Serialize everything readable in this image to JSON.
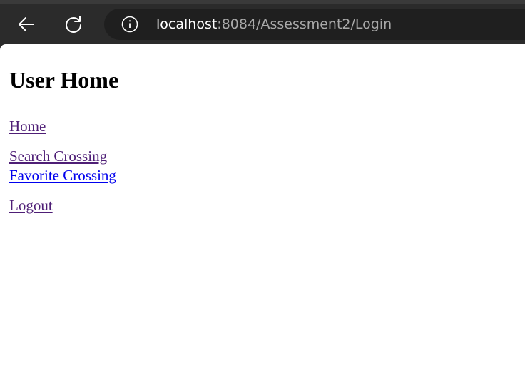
{
  "browser": {
    "url_host": "localhost",
    "url_path": ":8084/Assessment2/Login",
    "icons": {
      "back": "back-arrow-icon",
      "reload": "reload-icon",
      "info": "info-icon"
    }
  },
  "page": {
    "title": "User Home",
    "links": {
      "home": "Home",
      "search_crossing": "Search Crossing",
      "favorite_crossing": "Favorite Crossing",
      "logout": "Logout"
    }
  },
  "colors": {
    "visited_link": "#4e1e76",
    "unvisited_link": "#0000ee",
    "toolbar_bg": "#2b2b2b"
  }
}
